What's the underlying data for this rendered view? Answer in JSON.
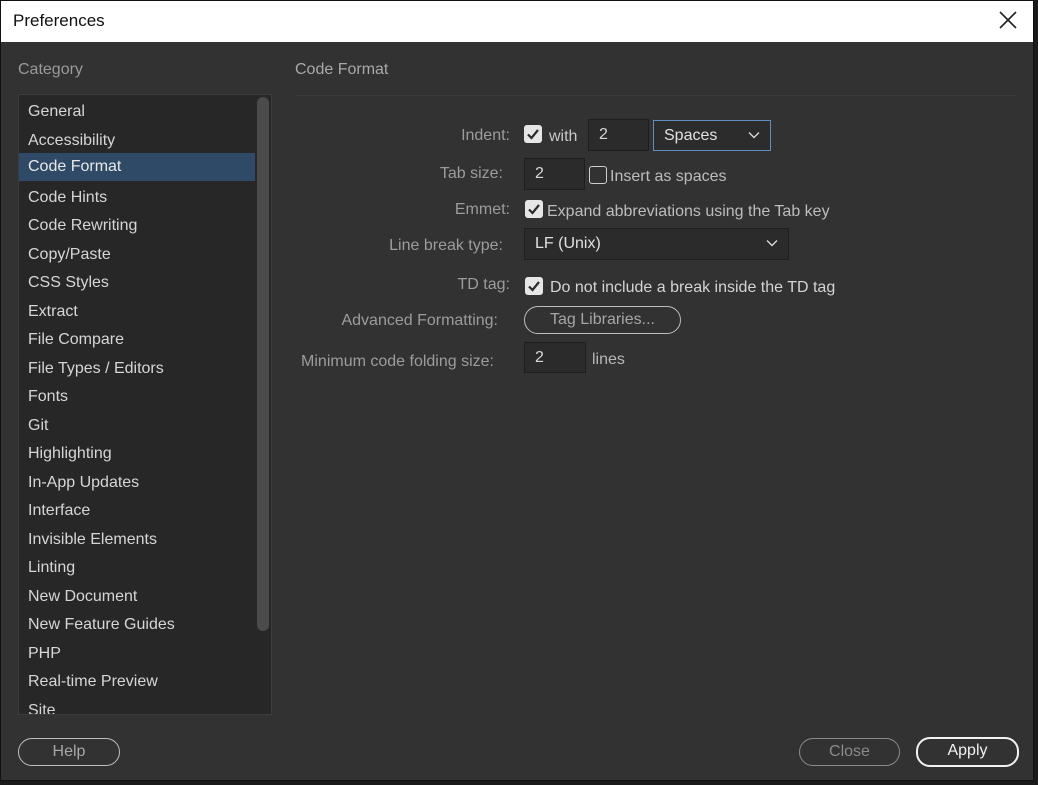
{
  "window": {
    "title": "Preferences"
  },
  "sidebar": {
    "heading": "Category",
    "items": [
      {
        "label": "General"
      },
      {
        "label": "Accessibility"
      },
      {
        "label": "Code Format",
        "selected": true
      },
      {
        "label": "Code Hints"
      },
      {
        "label": "Code Rewriting"
      },
      {
        "label": "Copy/Paste"
      },
      {
        "label": "CSS Styles"
      },
      {
        "label": "Extract"
      },
      {
        "label": "File Compare"
      },
      {
        "label": "File Types / Editors"
      },
      {
        "label": "Fonts"
      },
      {
        "label": "Git"
      },
      {
        "label": "Highlighting"
      },
      {
        "label": "In-App Updates"
      },
      {
        "label": "Interface"
      },
      {
        "label": "Invisible Elements"
      },
      {
        "label": "Linting"
      },
      {
        "label": "New Document"
      },
      {
        "label": "New Feature Guides"
      },
      {
        "label": "PHP"
      },
      {
        "label": "Real-time Preview"
      },
      {
        "label": "Site"
      }
    ]
  },
  "panel": {
    "heading": "Code Format",
    "indent": {
      "label": "Indent:",
      "checked": true,
      "with_text": "with",
      "value": "2",
      "unit_selected": "Spaces"
    },
    "tab_size": {
      "label": "Tab size:",
      "value": "2",
      "insert_as_spaces_label": "Insert as spaces",
      "insert_as_spaces_checked": false
    },
    "emmet": {
      "label": "Emmet:",
      "checked": true,
      "option_label": "Expand abbreviations using the Tab key"
    },
    "line_break": {
      "label": "Line break type:",
      "selected": "LF (Unix)"
    },
    "td_tag": {
      "label": "TD tag:",
      "checked": true,
      "option_label": "Do not include a break inside the TD tag"
    },
    "advanced": {
      "label": "Advanced Formatting:",
      "button_label": "Tag Libraries..."
    },
    "folding": {
      "label": "Minimum code folding size:",
      "value": "2",
      "unit": "lines"
    }
  },
  "footer": {
    "help_label": "Help",
    "close_label": "Close",
    "apply_label": "Apply"
  },
  "colors": {
    "accent": "#2f4a66",
    "focus": "#5e8ec2",
    "background": "#323232"
  }
}
